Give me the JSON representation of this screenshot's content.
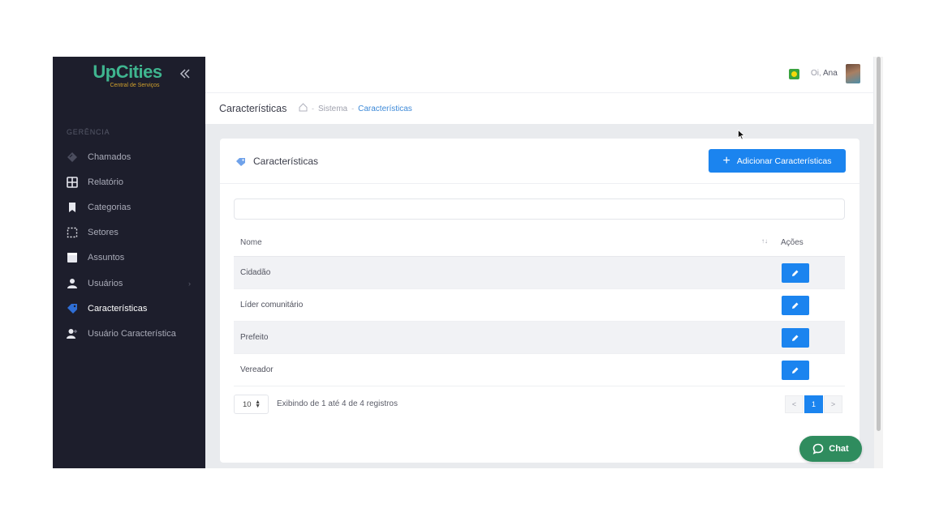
{
  "brand": {
    "name": "UpCities",
    "tagline": "Central de Serviços"
  },
  "sidebar": {
    "section_label": "GERÊNCIA",
    "items": [
      {
        "label": "Chamados",
        "icon": "ticket-icon",
        "active": false
      },
      {
        "label": "Relatório",
        "icon": "grid-icon",
        "active": false
      },
      {
        "label": "Categorias",
        "icon": "bookmark-icon",
        "active": false
      },
      {
        "label": "Setores",
        "icon": "dotted-square-icon",
        "active": false
      },
      {
        "label": "Assuntos",
        "icon": "calendar-icon",
        "active": false
      },
      {
        "label": "Usuários",
        "icon": "user-icon",
        "active": false,
        "caret": "›"
      },
      {
        "label": "Características",
        "icon": "tag-icon",
        "active": true
      },
      {
        "label": "Usuário Característica",
        "icon": "user-plus-icon",
        "active": false
      }
    ]
  },
  "header": {
    "greeting": "Oi,",
    "user_name": "Ana"
  },
  "subheader": {
    "title": "Características",
    "breadcrumb": {
      "sep1": "-",
      "item1": "Sistema",
      "sep2": "-",
      "current": "Características"
    }
  },
  "card": {
    "title": "Características",
    "add_button_label": "Adicionar Características",
    "add_button_icon": "+",
    "table": {
      "columns": [
        "Nome",
        "Ações"
      ],
      "sort_indicator": "↑↓",
      "rows": [
        {
          "name": "Cidadão"
        },
        {
          "name": "Líder comunitário"
        },
        {
          "name": "Prefeito"
        },
        {
          "name": "Vereador"
        }
      ]
    },
    "page_size": "10",
    "info": "Exibindo de 1 até 4 de 4 registros",
    "pagination": {
      "prev": "<",
      "current": "1",
      "next": ">"
    }
  },
  "chat": {
    "label": "Chat"
  },
  "colors": {
    "primary": "#1b84ef",
    "sidebar_bg": "#1d1e2c",
    "brand_green": "#3fb58f",
    "chat_green": "#2f8c5e"
  }
}
